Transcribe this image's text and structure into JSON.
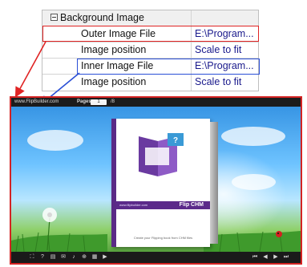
{
  "property_grid": {
    "category": {
      "label": "Background Image",
      "toggle_icon": "minus-box-icon"
    },
    "rows": [
      {
        "label": "Outer Image File",
        "value": "E:\\Program..."
      },
      {
        "label": "Image position",
        "value": "Scale to fit"
      },
      {
        "label": "Inner Image File",
        "value": "E:\\Program..."
      },
      {
        "label": "Image position",
        "value": "Scale to fit"
      }
    ],
    "highlight_colors": {
      "outer": "#e02424",
      "inner": "#2a4fd6"
    }
  },
  "preview": {
    "site_text": "www.FlipBuilder.com",
    "pages_label": "Pages:",
    "page_value": "1",
    "page_total": "/8",
    "book": {
      "cover_title": "Flip CHM",
      "cover_subtitle": "www.flipbuilder.com",
      "footer": "Create your Flipping book from CHM files"
    },
    "bottom_icons": [
      "fullscreen-icon",
      "help-icon",
      "print-icon",
      "share-icon",
      "sound-icon",
      "zoom-icon",
      "thumbnail-icon",
      "autoplay-icon",
      "first-page-icon",
      "previous-page-icon",
      "next-page-icon",
      "last-page-icon"
    ],
    "border_color": "#d42323"
  }
}
